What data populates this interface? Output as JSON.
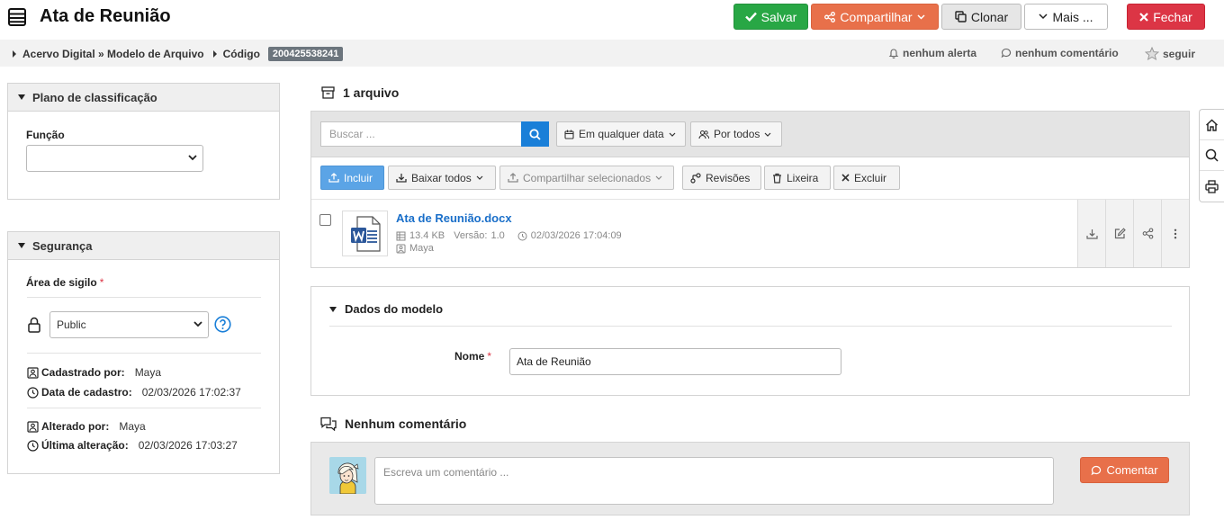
{
  "header": {
    "title": "Ata de Reunião",
    "save_label": "Salvar",
    "share_label": "Compartilhar",
    "clone_label": "Clonar",
    "more_label": "Mais ...",
    "close_label": "Fechar"
  },
  "breadcrumb": {
    "path": "Acervo Digital » Modelo de Arquivo",
    "code_label": "Código",
    "code_value": "200425538241",
    "alerts": "nenhum alerta",
    "comments": "nenhum comentário",
    "follow": "seguir"
  },
  "classification": {
    "title": "Plano de classificação",
    "function_label": "Função",
    "function_value": ""
  },
  "security": {
    "title": "Segurança",
    "secrecy_label": "Área de sigilo",
    "secrecy_required": "*",
    "secrecy_value": "Public",
    "created_by_label": "Cadastrado por:",
    "created_by": "Maya",
    "created_date_label": "Data de cadastro:",
    "created_date": "02/03/2026 17:02:37",
    "changed_by_label": "Alterado por:",
    "changed_by": "Maya",
    "changed_date_label": "Última alteração:",
    "changed_date": "02/03/2026 17:03:27"
  },
  "files": {
    "title": "1 arquivo",
    "search_placeholder": "Buscar ...",
    "date_filter": "Em qualquer data",
    "user_filter": "Por todos",
    "toolbar": {
      "include": "Incluir",
      "download_all": "Baixar todos",
      "share_selected": "Compartilhar selecionados",
      "revisions": "Revisões",
      "trash": "Lixeira",
      "delete": "Excluir"
    },
    "items": [
      {
        "name": "Ata de Reunião.docx",
        "size": "13.4 KB",
        "version_label": "Versão:",
        "version": "1.0",
        "date": "02/03/2026 17:04:09",
        "owner": "Maya"
      }
    ]
  },
  "model": {
    "title": "Dados do modelo",
    "name_label": "Nome",
    "name_required": "*",
    "name_value": "Ata de Reunião"
  },
  "comments": {
    "title": "Nenhum comentário",
    "placeholder": "Escreva um comentário ...",
    "button": "Comentar"
  },
  "colors": {
    "save": "#28a745",
    "share": "#e8704a",
    "close": "#dc3545",
    "primary": "#1a7fd8",
    "link": "#1a6fc9"
  }
}
